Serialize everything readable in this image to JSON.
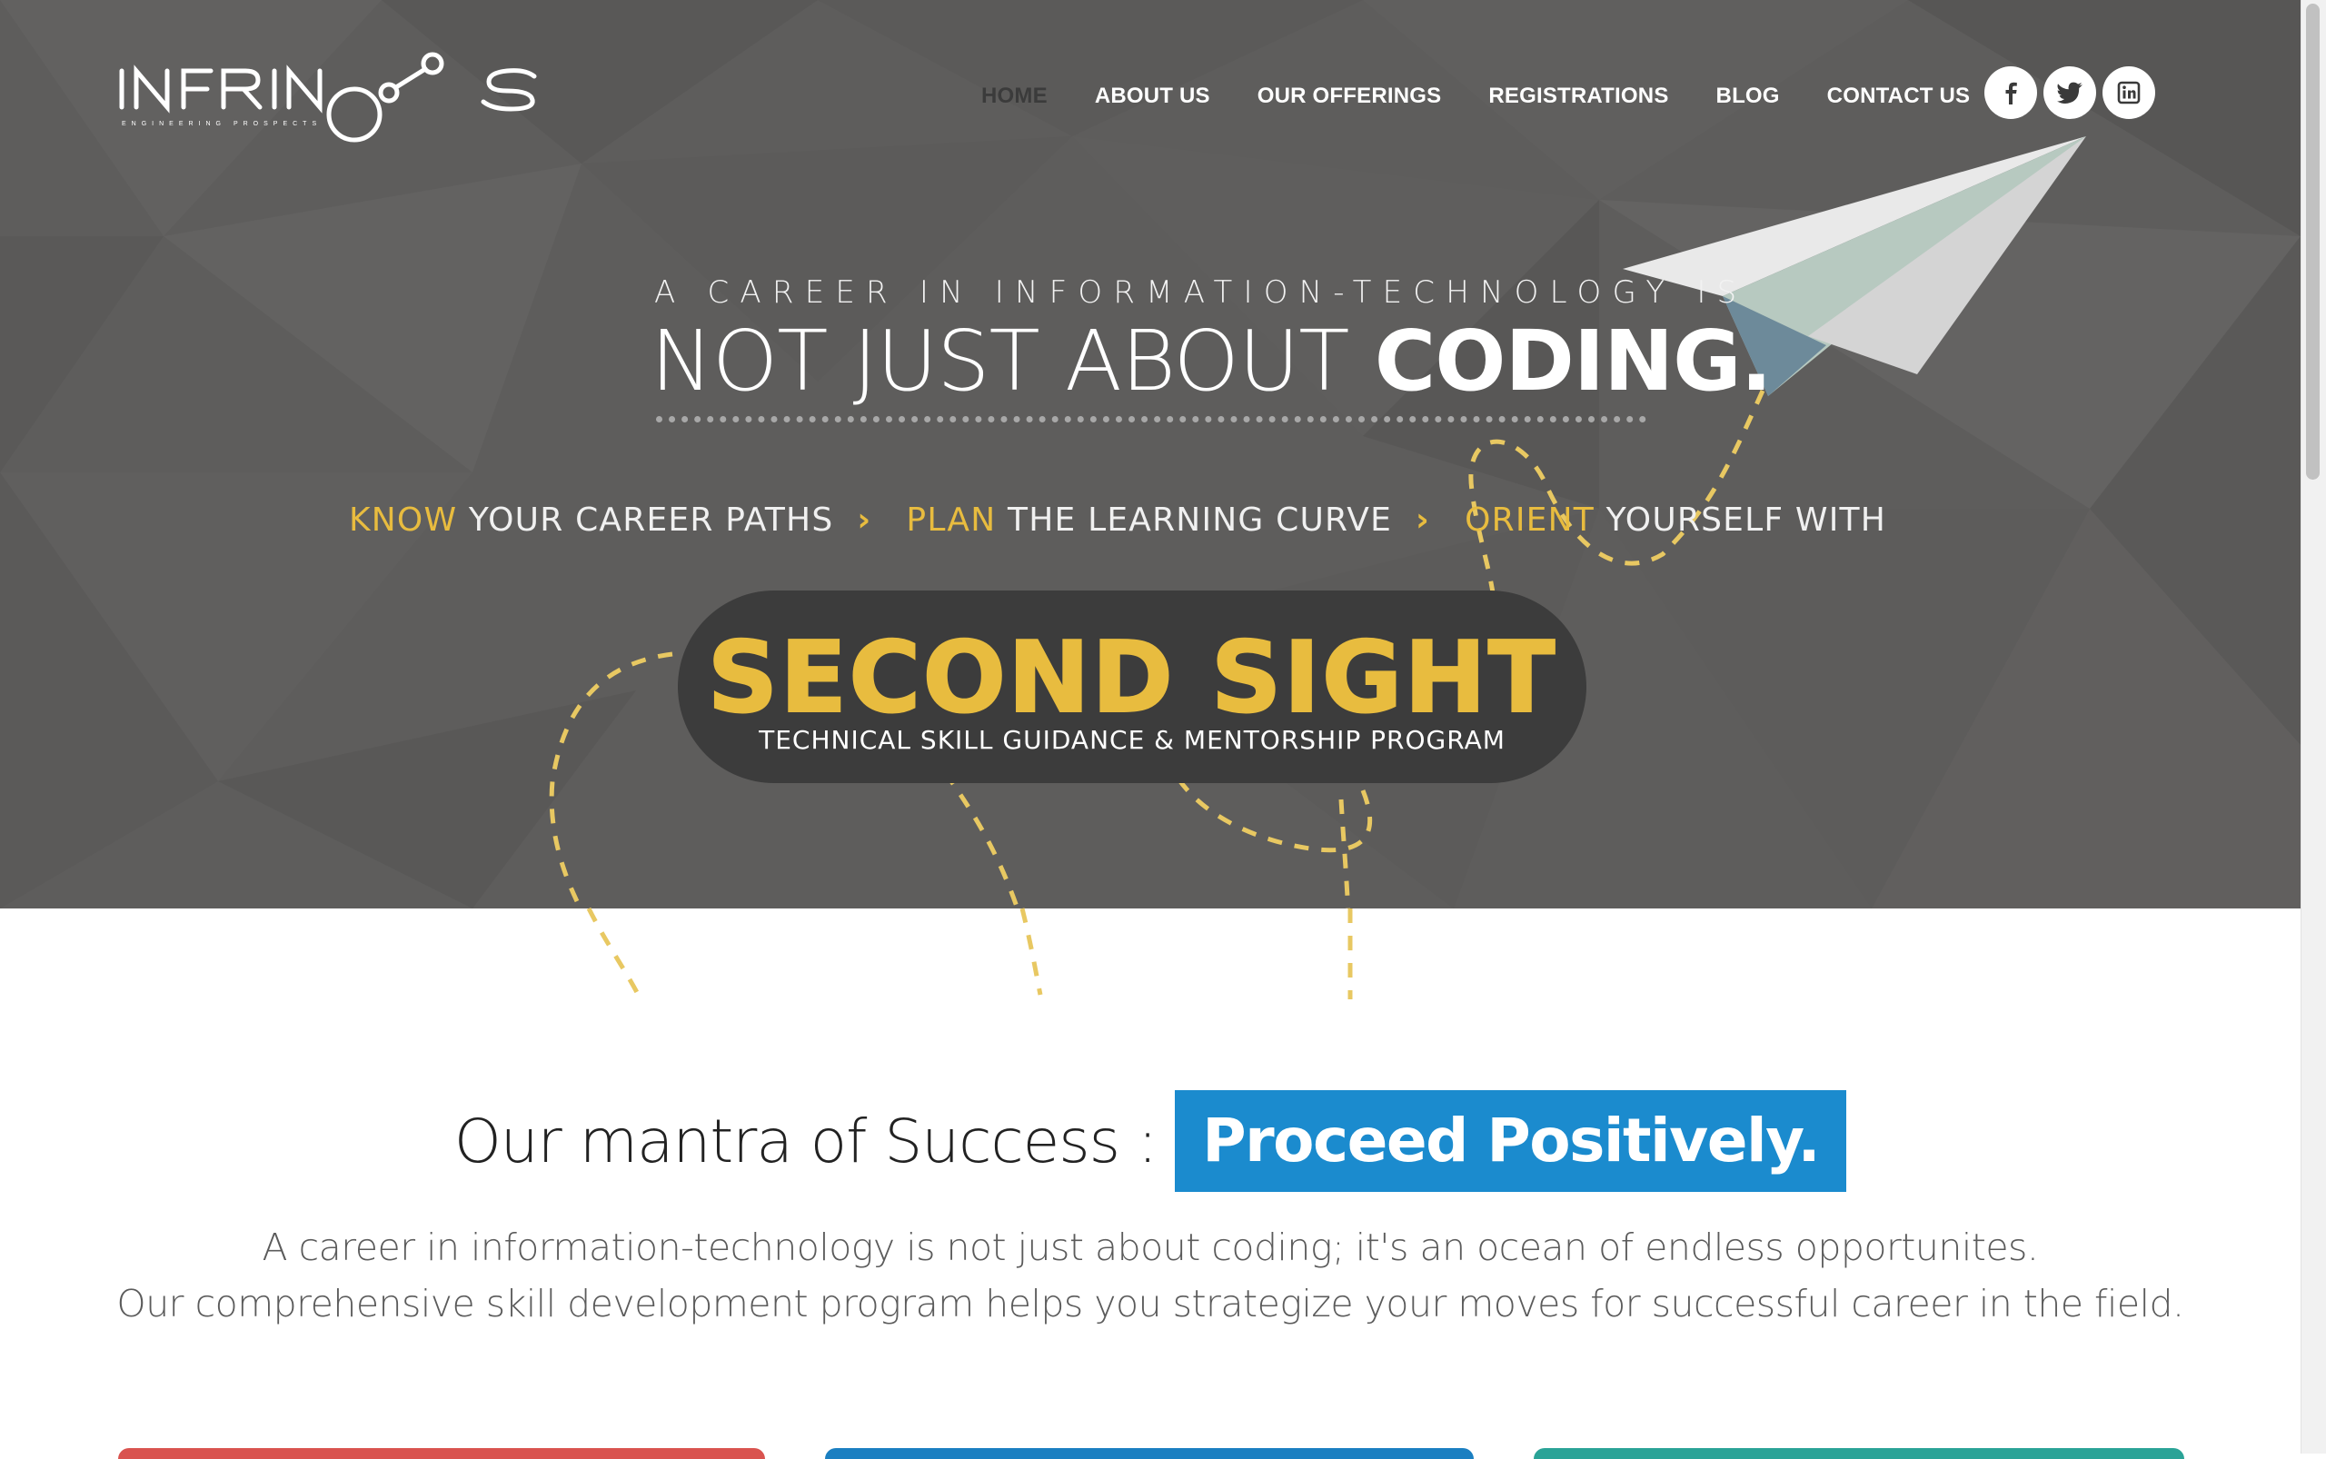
{
  "brand": {
    "logo_text": "INFRINOS",
    "tagline": "ENGINEERING PROSPECTS"
  },
  "nav": {
    "items": [
      {
        "label": "HOME",
        "active": true
      },
      {
        "label": "ABOUT US",
        "active": false
      },
      {
        "label": "OUR OFFERINGS",
        "active": false
      },
      {
        "label": "REGISTRATIONS",
        "active": false
      },
      {
        "label": "BLOG",
        "active": false
      },
      {
        "label": "CONTACT US",
        "active": false
      }
    ],
    "social": [
      {
        "name": "facebook-icon"
      },
      {
        "name": "twitter-icon"
      },
      {
        "name": "linkedin-icon"
      }
    ]
  },
  "hero": {
    "kicker": "A CAREER IN INFORMATION-TECHNOLOGY IS",
    "headline_light": "NOT JUST ABOUT ",
    "headline_bold": "CODING.",
    "steps": [
      {
        "highlight": "KNOW",
        "rest": " YOUR CAREER PATHS"
      },
      {
        "highlight": "PLAN",
        "rest": " THE LEARNING CURVE"
      },
      {
        "highlight": "ORIENT",
        "rest": " YOURSELF WITH"
      }
    ],
    "chevron": "›",
    "badge_title": "SECOND SIGHT",
    "badge_subtitle": "TECHNICAL SKILL GUIDANCE & MENTORSHIP PROGRAM"
  },
  "mantra": {
    "label": "Our mantra of Success :",
    "highlight": "Proceed Positively."
  },
  "intro": {
    "line1": "A career in information-technology is not just about coding; it's an ocean of endless opportunites.",
    "line2": "Our comprehensive skill development program helps you strategize your moves for successful career in the field."
  },
  "colors": {
    "hero_bg": "#5e5d5c",
    "accent_yellow": "#e8bc3f",
    "accent_blue": "#1b8bce",
    "card_red": "#d9534f",
    "card_blue": "#1b7fc1",
    "card_teal": "#2aa397"
  }
}
